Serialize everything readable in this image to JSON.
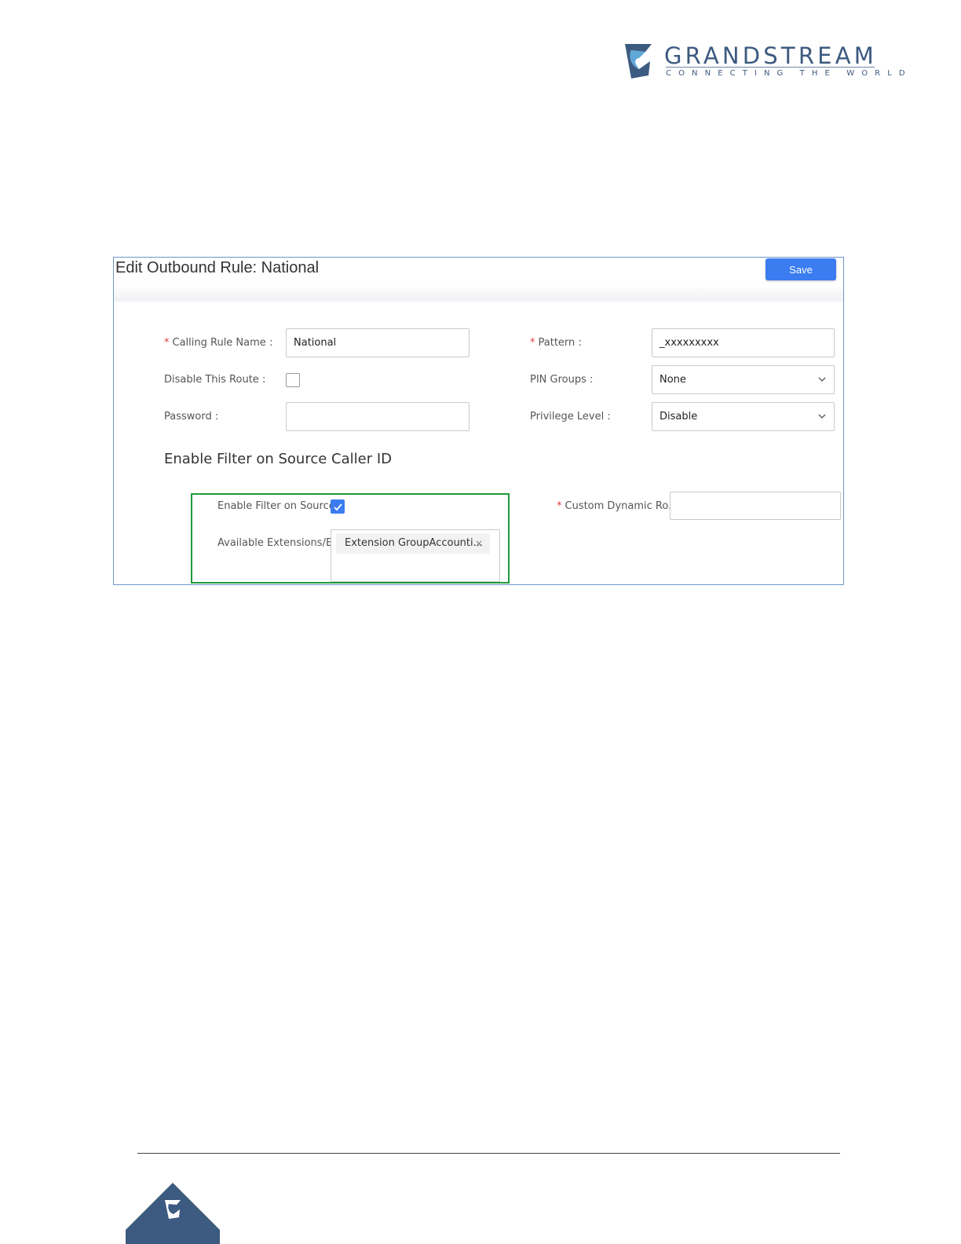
{
  "header": {
    "brand": "GRANDSTREAM",
    "tagline": "CONNECTING THE WORLD",
    "logo_icon": "grandstream-logo-icon"
  },
  "dialog": {
    "title": "Edit Outbound Rule: National",
    "save_label": "Save",
    "fields": {
      "calling_rule_name": {
        "label": "Calling Rule Name",
        "value": "National",
        "required": "*"
      },
      "disable_route": {
        "label": "Disable This Route"
      },
      "password": {
        "label": "Password",
        "value": ""
      },
      "pattern": {
        "label": "Pattern",
        "value": "_xxxxxxxxx",
        "required": "*"
      },
      "pin_groups": {
        "label": "PIN Groups",
        "value": "None"
      },
      "privilege_level": {
        "label": "Privilege Level",
        "value": "Disable"
      }
    },
    "colon": ":",
    "section_title": "Enable Filter on Source Caller ID",
    "filter": {
      "enable_label": "Enable Filter on Source...",
      "available_label": "Available Extensions/E...",
      "selected_tag": "Extension GroupAccounti...",
      "tag_close": "×",
      "custom_dynamic_label": "Custom Dynamic Ro...",
      "custom_dynamic_required": "*",
      "custom_dynamic_value": ""
    }
  },
  "colors": {
    "accent": "#3b7cf0",
    "highlight": "#1f9b3a",
    "brand": "#3d5a80",
    "required": "#e03c3c"
  }
}
